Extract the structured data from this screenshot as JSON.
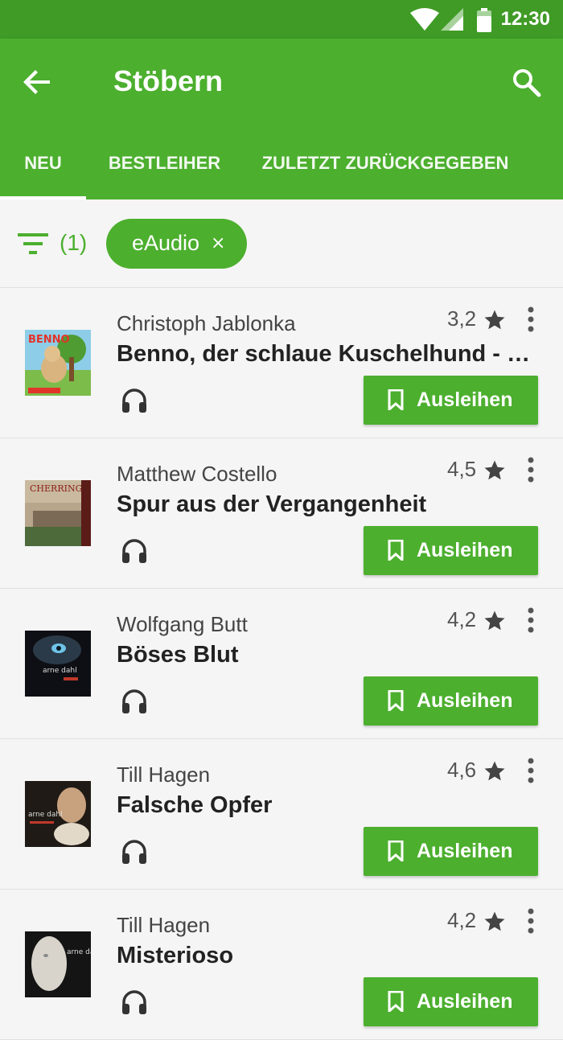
{
  "status_bar": {
    "time": "12:30"
  },
  "app_bar": {
    "title": "Stöbern"
  },
  "tabs": [
    {
      "label": "NEU",
      "active": true
    },
    {
      "label": "BESTLEIHER",
      "active": false
    },
    {
      "label": "ZULETZT ZURÜCKGEGEBEN",
      "active": false
    }
  ],
  "filter": {
    "count": "(1)",
    "chip_label": "eAudio",
    "chip_close": "×"
  },
  "colors": {
    "primary": "#4caf2e",
    "status_bar": "#3f9b26"
  },
  "items": [
    {
      "author": "Christoph Jablonka",
      "title": "Benno, der schlaue Kuschelhund - Jahreszeiten",
      "rating": "3,2",
      "action": "Ausleihen",
      "media_icon": "headphones-icon"
    },
    {
      "author": "Matthew Costello",
      "title": "Spur aus der Vergangenheit",
      "rating": "4,5",
      "action": "Ausleihen",
      "media_icon": "headphones-icon"
    },
    {
      "author": "Wolfgang Butt",
      "title": "Böses Blut",
      "rating": "4,2",
      "action": "Ausleihen",
      "media_icon": "headphones-icon"
    },
    {
      "author": "Till Hagen",
      "title": "Falsche Opfer",
      "rating": "4,6",
      "action": "Ausleihen",
      "media_icon": "headphones-icon"
    },
    {
      "author": "Till Hagen",
      "title": "Misterioso",
      "rating": "4,2",
      "action": "Ausleihen",
      "media_icon": "headphones-icon"
    }
  ]
}
